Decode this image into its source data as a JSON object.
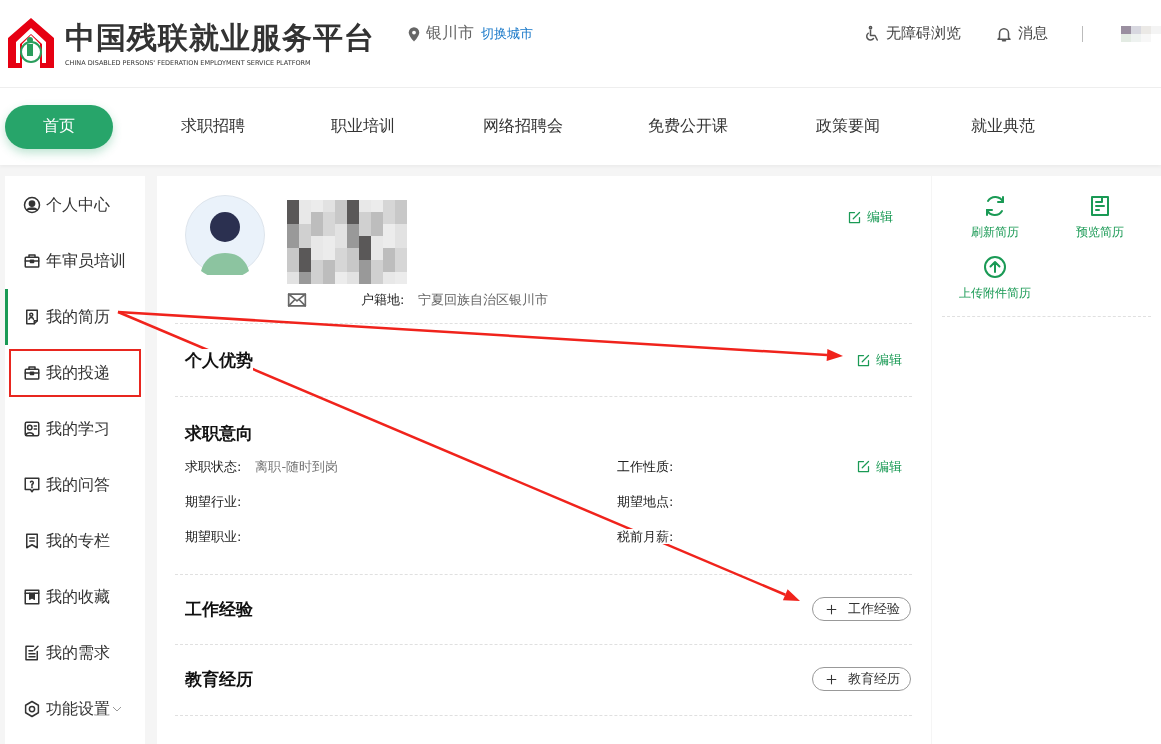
{
  "header": {
    "logo_title": "中国残联就业服务平台",
    "logo_subtitle": "CHINA DISABLED PERSONS' FEDERATION EMPLOYMENT SERVICE PLATFORM",
    "city": "银川市",
    "switch_city": "切换城市",
    "accessibility": "无障碍浏览",
    "messages": "消息"
  },
  "nav": [
    {
      "label": "首页",
      "selected": true
    },
    {
      "label": "求职招聘",
      "selected": false
    },
    {
      "label": "职业培训",
      "selected": false
    },
    {
      "label": "网络招聘会",
      "selected": false
    },
    {
      "label": "免费公开课",
      "selected": false
    },
    {
      "label": "政策要闻",
      "selected": false
    },
    {
      "label": "就业典范",
      "selected": false
    }
  ],
  "sidebar": {
    "items": [
      {
        "label": "个人中心",
        "selected": false,
        "highlighted": false
      },
      {
        "label": "年审员培训",
        "selected": false,
        "highlighted": false
      },
      {
        "label": "我的简历",
        "selected": true,
        "highlighted": false
      },
      {
        "label": "我的投递",
        "selected": false,
        "highlighted": true
      },
      {
        "label": "我的学习",
        "selected": false,
        "highlighted": false
      },
      {
        "label": "我的问答",
        "selected": false,
        "highlighted": false
      },
      {
        "label": "我的专栏",
        "selected": false,
        "highlighted": false
      },
      {
        "label": "我的收藏",
        "selected": false,
        "highlighted": false
      },
      {
        "label": "我的需求",
        "selected": false,
        "highlighted": false
      },
      {
        "label": "功能设置",
        "selected": false,
        "highlighted": false,
        "expanded": false
      }
    ]
  },
  "profile": {
    "edit": "编辑",
    "hukou_label": "户籍地:",
    "hukou_value": "宁夏回族自治区银川市"
  },
  "sections": [
    {
      "title": "个人优势",
      "action": {
        "kind": "edit",
        "label": "编辑"
      }
    },
    {
      "title": "求职意向",
      "action": {
        "kind": "edit",
        "label": "编辑"
      },
      "fields": [
        {
          "label": "求职状态:",
          "value": "离职-随时到岗"
        },
        {
          "label": "工作性质:"
        },
        {
          "label": "期望行业:"
        },
        {
          "label": "期望地点:"
        },
        {
          "label": "期望职业:"
        },
        {
          "label": "税前月薪:"
        }
      ]
    },
    {
      "title": "工作经验",
      "action": {
        "kind": "add",
        "label": "工作经验"
      }
    },
    {
      "title": "教育经历",
      "action": {
        "kind": "add",
        "label": "教育经历"
      }
    }
  ],
  "tools": [
    {
      "label": "刷新简历"
    },
    {
      "label": "预览简历"
    },
    {
      "label": "上传附件简历"
    }
  ]
}
